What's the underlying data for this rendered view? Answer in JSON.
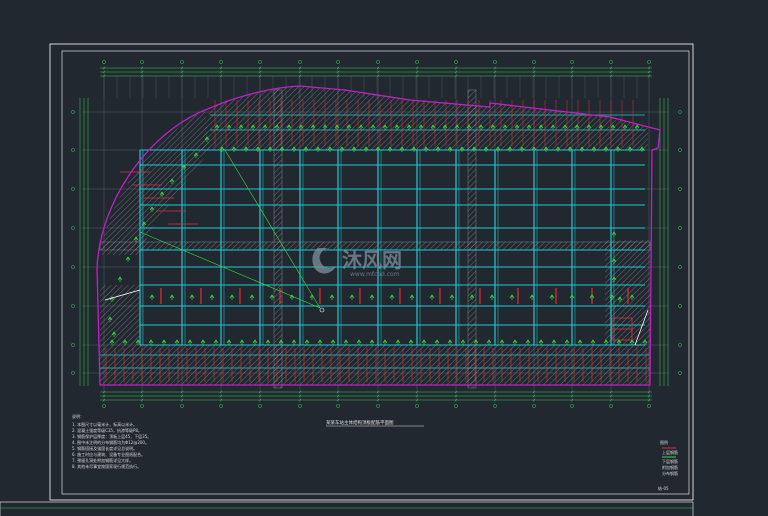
{
  "drawing": {
    "title": "某某车站主体结构顶板配筋平面图",
    "watermark_text": "沐风网",
    "watermark_url": "www.mfcad.com",
    "sheet_number": "结-05",
    "colors": {
      "background": "#212830",
      "frame": "#ffffff",
      "grid_dim": "#39d353",
      "beam": "#20c8d0",
      "rebar_red": "#e0303a",
      "rebar_green": "#38e040",
      "outline_magenta": "#c020c8",
      "hatch": "#9a9a9a",
      "watermark": "#7f8fa0"
    },
    "notes": {
      "heading": "说明：",
      "lines": [
        "1. 本图尺寸以毫米计，标高以米计。",
        "2. 混凝土强度等级C35，抗渗等级P8。",
        "3. 钢筋保护层厚度：顶板上层45，下层35。",
        "4. 图中未注明的分布钢筋均为Φ12@200。",
        "5. 钢筋搭接及锚固长度详见总说明。",
        "6. 施工时应与建筑、设备专业图纸配合。",
        "7. 预留孔洞处附加钢筋详见大样。",
        "8. 其他未尽事宜按国家现行规范执行。"
      ]
    },
    "legend": {
      "heading": "图例",
      "lines": [
        "上层钢筋",
        "下层钢筋",
        "附加钢筋",
        "分布钢筋"
      ]
    }
  }
}
